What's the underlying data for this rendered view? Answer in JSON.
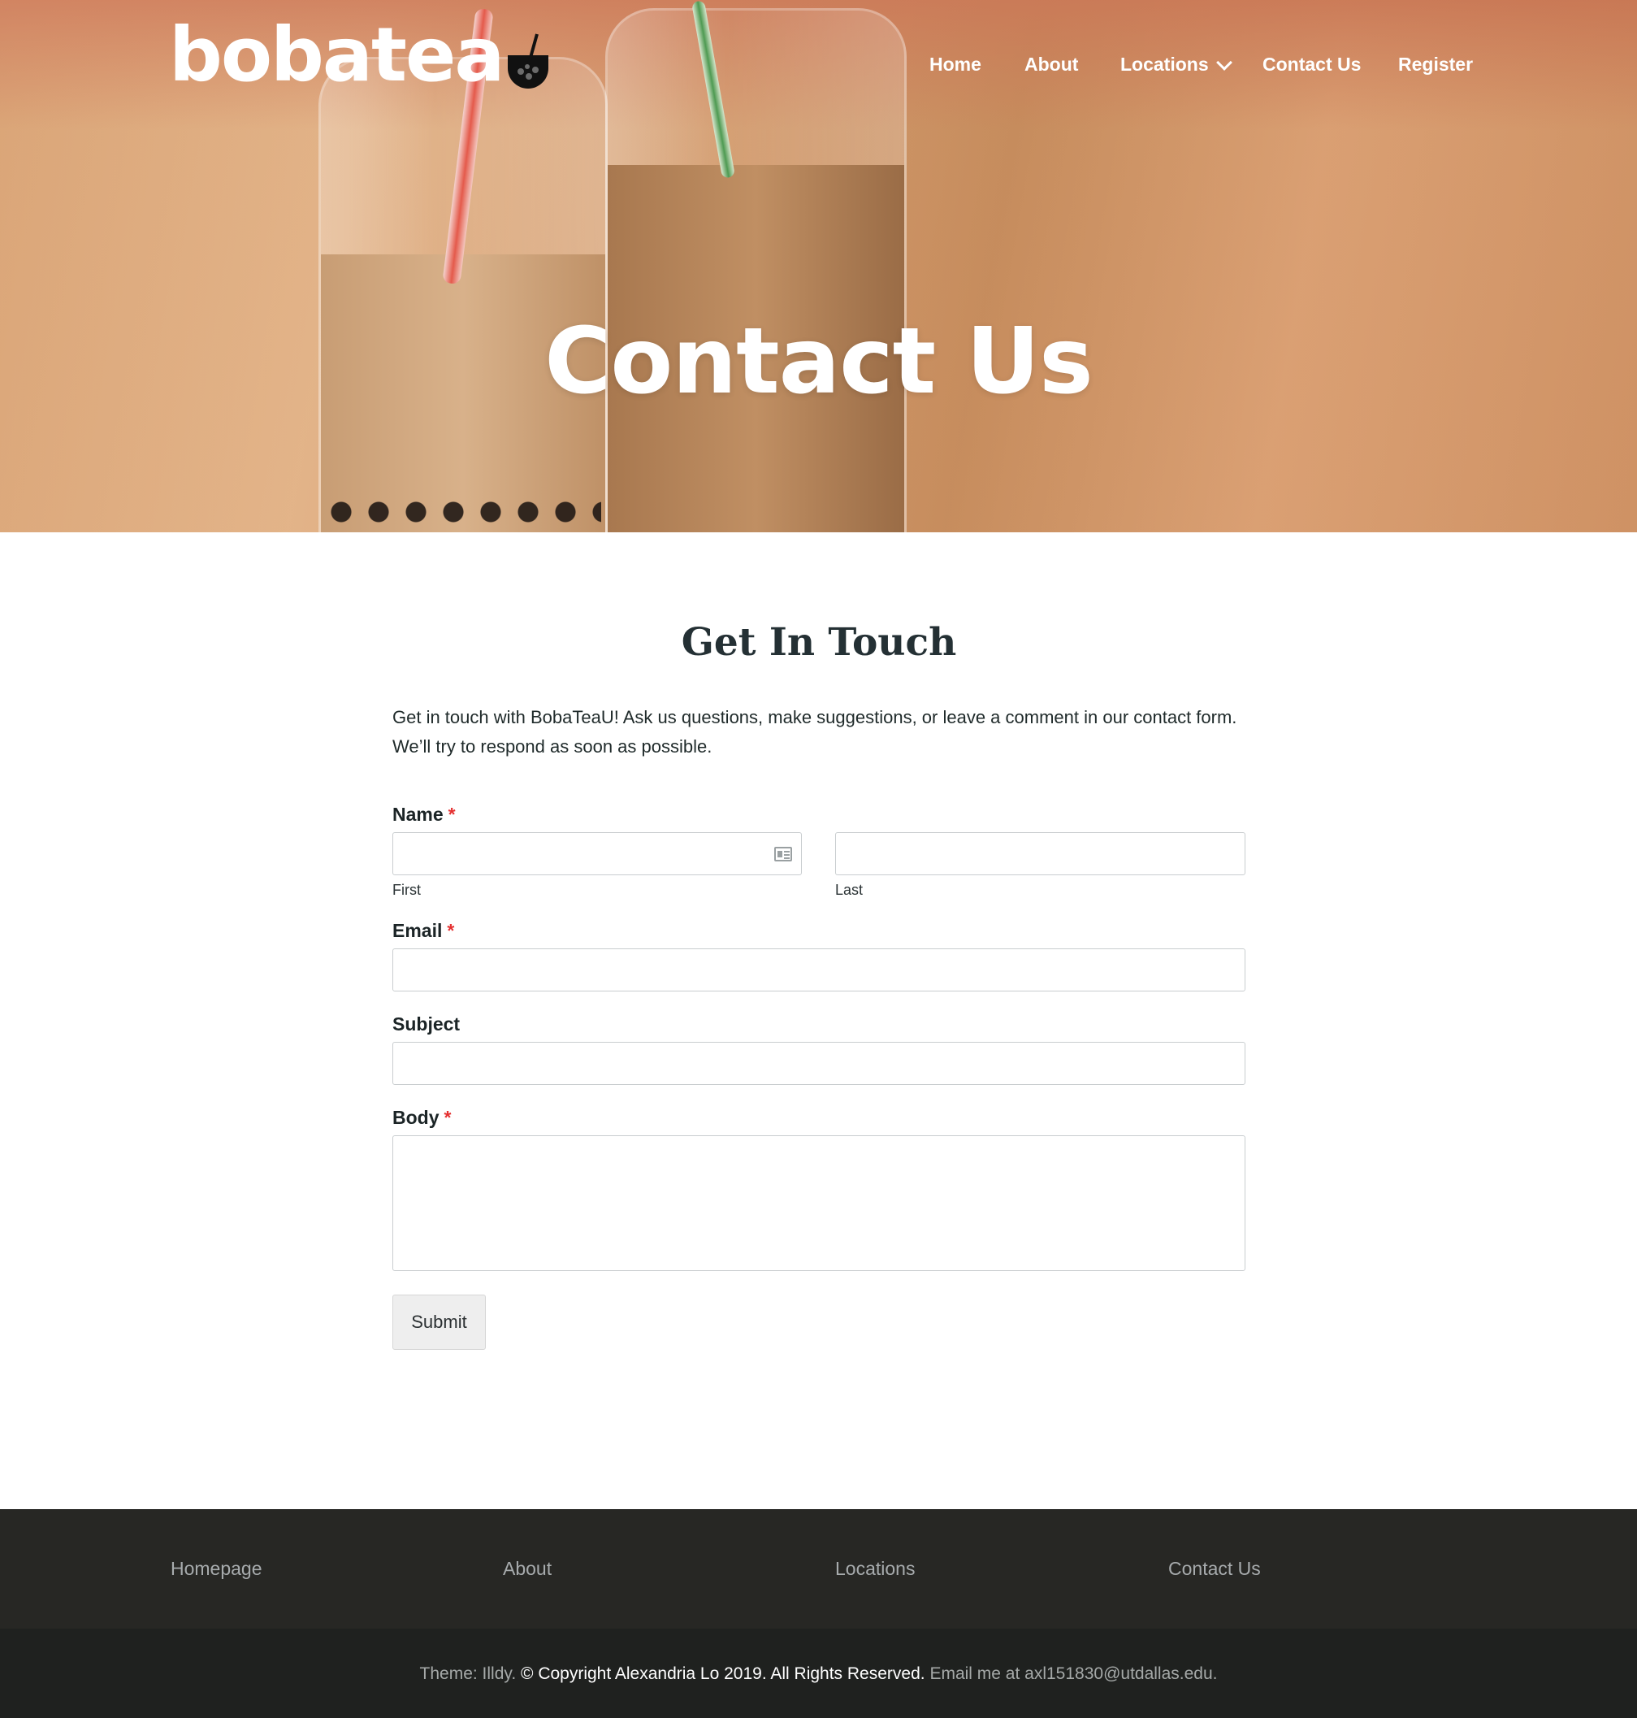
{
  "brand": {
    "logo_text": "bobatea",
    "logo_mark": "U"
  },
  "nav": {
    "items": [
      {
        "label": "Home"
      },
      {
        "label": "About"
      },
      {
        "label": "Locations"
      },
      {
        "label": "Contact Us"
      },
      {
        "label": "Register"
      }
    ]
  },
  "hero": {
    "title": "Contact Us"
  },
  "main": {
    "heading": "Get In Touch",
    "intro": "Get in touch with BobaTeaU! Ask us questions, make suggestions, or leave a comment in our contact form. We’ll try to respond as soon as possible."
  },
  "form": {
    "name_label": "Name",
    "first_sublabel": "First",
    "last_sublabel": "Last",
    "email_label": "Email",
    "subject_label": "Subject",
    "body_label": "Body",
    "required_mark": "*",
    "first_value": "",
    "last_value": "",
    "email_value": "",
    "subject_value": "",
    "body_value": "",
    "submit_label": "Submit"
  },
  "footer": {
    "links": [
      {
        "label": "Homepage"
      },
      {
        "label": "About"
      },
      {
        "label": "Locations"
      },
      {
        "label": "Contact Us"
      }
    ],
    "theme_text": "Theme: Illdy.",
    "copyright_text": "© Copyright Alexandria Lo 2019. All Rights Reserved.",
    "email_text": "Email me at axl151830@utdallas.edu."
  },
  "colors": {
    "hero_overlay": "#ce7856",
    "required": "#e53131",
    "footer_top": "#272724",
    "footer_bottom": "#1f211f",
    "footer_link": "#a7abad"
  }
}
